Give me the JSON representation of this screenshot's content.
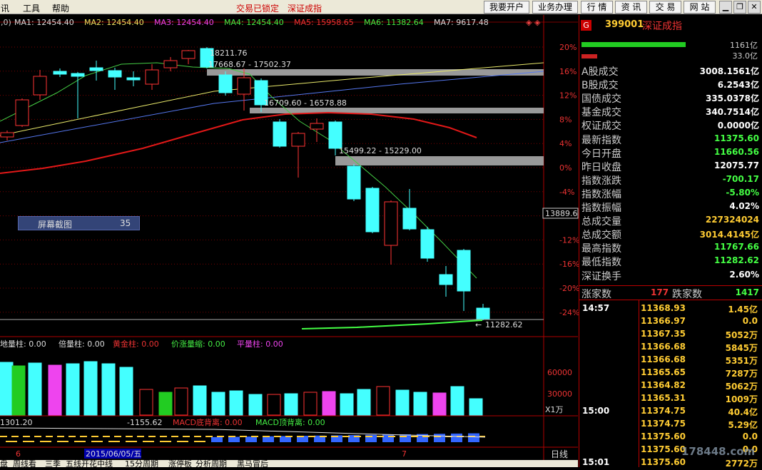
{
  "menu": {
    "items": [
      "讯",
      "工具",
      "帮助"
    ],
    "status1": "交易已锁定",
    "status2": "深证成指",
    "buttons": [
      "我要开户",
      "业务办理",
      "行 情",
      "资 讯",
      "交 易",
      "网 站"
    ]
  },
  "ma": {
    "prefix": ",0)",
    "ma1": "MA1: 12454.40",
    "ma2": "MA2: 12454.40",
    "ma3": "MA3: 12454.40",
    "ma4": "MA4: 12454.40",
    "ma5": "MA5: 15958.65",
    "ma6": "MA6: 11382.64",
    "ma7": "MA7: 9617.48"
  },
  "price_labels": {
    "high": "18211.76",
    "gap1": "17668.67 - 17502.37",
    "gap2": "16709.60 - 16578.88",
    "gap3": "15499.22 - 15229.00",
    "low": "11282.62",
    "cursor": "13889.6"
  },
  "axis": {
    "pct": [
      "20%",
      "16%",
      "12%",
      "8%",
      "4%",
      "0%",
      "-4%",
      "-8%",
      "-12%",
      "-16%",
      "-20%",
      "-24%"
    ],
    "vol": [
      "60000",
      "30000"
    ],
    "vol_unit": "X1万"
  },
  "screenshot": {
    "label": "屏幕截图",
    "value": "35"
  },
  "indicators": {
    "i0": "地量柱: 0.00",
    "i1": "倍量柱: 0.00",
    "i2": "黄金柱: 0.00",
    "i3": "价涨量缩: 0.00",
    "i4": "平量柱: 0.00"
  },
  "macd": {
    "m0": "1301.20",
    "m1": "-1155.62",
    "m2": "MACD底背离: 0.00",
    "m3": "MACD顶背离: 0.00"
  },
  "dates": {
    "d0": "6",
    "d1": "2015/06/05/五",
    "d2": "7",
    "period": "日线"
  },
  "bottom_tabs": [
    "盘",
    "周线看",
    "三季",
    "五线开花中线",
    "15分周期",
    "涨停板",
    "分析周期",
    "黑马冒后"
  ],
  "panel": {
    "code": "399001",
    "name": "深证成指",
    "top1": "1161亿",
    "top2": "33.0亿",
    "rows": [
      {
        "label": "A股成交",
        "value": "3008.1561亿",
        "color": "#ffffff"
      },
      {
        "label": "B股成交",
        "value": "6.2543亿",
        "color": "#ffffff"
      },
      {
        "label": "国债成交",
        "value": "335.0378亿",
        "color": "#ffffff"
      },
      {
        "label": "基金成交",
        "value": "340.7514亿",
        "color": "#ffffff"
      },
      {
        "label": "权证成交",
        "value": "0.0000亿",
        "color": "#ffffff"
      },
      {
        "label": "最新指数",
        "value": "11375.60",
        "color": "#44ff44"
      },
      {
        "label": "今日开盘",
        "value": "11660.56",
        "color": "#44ff44"
      },
      {
        "label": "昨日收盘",
        "value": "12075.77",
        "color": "#ffffff"
      },
      {
        "label": "指数涨跌",
        "value": "-700.17",
        "color": "#44ff44"
      },
      {
        "label": "指数涨幅",
        "value": "-5.80%",
        "color": "#44ff44"
      },
      {
        "label": "指数振幅",
        "value": "4.02%",
        "color": "#ffffff"
      },
      {
        "label": "总成交量",
        "value": "227324024",
        "color": "#ffcc33"
      },
      {
        "label": "总成交额",
        "value": "3014.4145亿",
        "color": "#ffcc33"
      },
      {
        "label": "最高指数",
        "value": "11767.66",
        "color": "#44ff44"
      },
      {
        "label": "最低指数",
        "value": "11282.62",
        "color": "#44ff44"
      },
      {
        "label": "深证换手",
        "value": "2.60%",
        "color": "#ffffff"
      }
    ],
    "rise_label": "涨家数",
    "rise": "177",
    "fall_label": "跌家数",
    "fall": "1417",
    "ticks": [
      {
        "time": "14:57",
        "price": "11368.93",
        "vol": "1.45亿"
      },
      {
        "time": "",
        "price": "11366.97",
        "vol": "0.0"
      },
      {
        "time": "",
        "price": "11367.35",
        "vol": "5052万"
      },
      {
        "time": "",
        "price": "11366.68",
        "vol": "5845万"
      },
      {
        "time": "",
        "price": "11366.68",
        "vol": "5351万"
      },
      {
        "time": "",
        "price": "11365.65",
        "vol": "7287万"
      },
      {
        "time": "",
        "price": "11364.82",
        "vol": "5062万"
      },
      {
        "time": "",
        "price": "11365.31",
        "vol": "1009万"
      },
      {
        "time": "15:00",
        "price": "11374.75",
        "vol": "40.4亿"
      },
      {
        "time": "",
        "price": "11374.75",
        "vol": "5.29亿"
      },
      {
        "time": "",
        "price": "11375.60",
        "vol": "0.0"
      },
      {
        "time": "",
        "price": "11375.60",
        "vol": "0.0"
      },
      {
        "time": "15:01",
        "price": "11375.60",
        "vol": "2772万"
      }
    ]
  },
  "watermark": "178448.com"
}
